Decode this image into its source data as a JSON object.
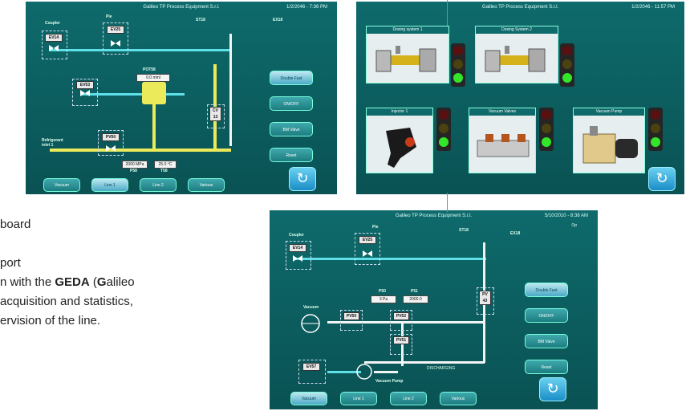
{
  "common": {
    "company": "Galileo TP Process Equipment S.r.l.",
    "refresh_icon": "refresh-icon"
  },
  "panel1": {
    "datetime": "1/2/2046 - 7:36 PM",
    "labels": {
      "coupler": "Coupler",
      "ev14": "EV14",
      "pie": "Pie",
      "ev25": "EV25",
      "st18": "ST18",
      "ex18": "EX18",
      "ev53": "EV53",
      "pot58": "POT58",
      "pot58_value": "0.0 mml",
      "refrigerant": "Refrigerant\ninlet 1",
      "pv50": "PV50",
      "pressure": "2000 MPa",
      "temperature": "25.0 °C",
      "p58": "P58",
      "t58": "T58",
      "cv": "CV\n13"
    },
    "side_buttons": [
      "Double Fast",
      "ON/OFF",
      "BM Valve",
      "Reset"
    ],
    "nav_buttons": [
      "Vacuum",
      "Line 1",
      "Line 2",
      "Various"
    ],
    "active_nav": "Line 1"
  },
  "panel2": {
    "datetime": "1/2/2046 - 11:57 PM",
    "cards": [
      {
        "label": "Dosing system 1",
        "status": "green"
      },
      {
        "label": "Dosing System 2",
        "status": "green"
      },
      {
        "label": "Injector 1",
        "status": "green"
      },
      {
        "label": "Vacuum Valves",
        "status": "green"
      },
      {
        "label": "Vacuum Pump",
        "status": "green"
      }
    ]
  },
  "panel3": {
    "datetime": "5/10/2010 - 8:38 AM",
    "status": "Op",
    "labels": {
      "coupler": "Coupler",
      "ev14": "EV14",
      "pie": "Pie",
      "ev25": "EV25",
      "st18": "ST18",
      "ex18": "EX18",
      "p50": "P50",
      "p51": "P51",
      "p50_value": "3 Pa",
      "p51_value": "2000.0",
      "vacuum": "Vacuum",
      "pv50": "PV50",
      "pv52": "PV52",
      "pv51": "PV51",
      "ev57": "EV57",
      "vacuum_pump": "Vacuum Pump",
      "discharging": "DISCHARGING",
      "pv": "PV\n43"
    },
    "side_buttons": [
      "Double Fast",
      "ON/OFF",
      "BM Valve",
      "Reset"
    ],
    "nav_buttons": [
      "Vacuum",
      "Line 1",
      "Line 2",
      "Various"
    ],
    "active_nav": "Vacuum"
  },
  "caption": {
    "line1": "board",
    "line2": "port",
    "line3_pre": "n with the ",
    "line3_bold": "GEDA",
    "line3_paren": " (",
    "line3_g": "G",
    "line3_post": "alileo",
    "line4": "acquisition and statistics,",
    "line5": "ervision of the line."
  }
}
